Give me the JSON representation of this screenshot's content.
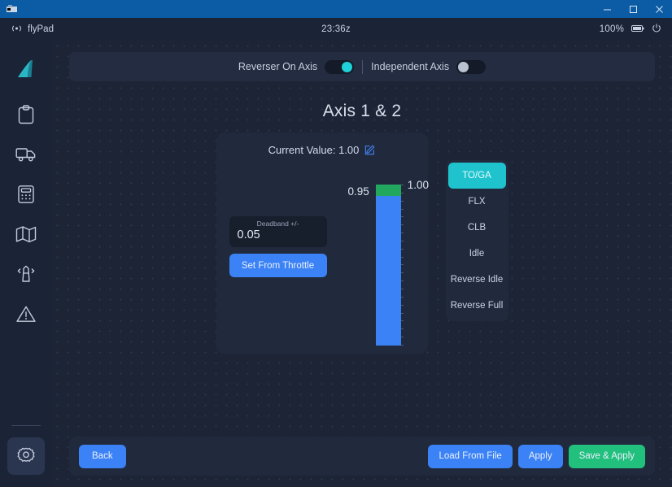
{
  "window": {
    "app_icon": "app-window-icon",
    "controls": {
      "minimize": "minimize-icon",
      "maximize": "maximize-icon",
      "close": "close-icon"
    }
  },
  "statusbar": {
    "connection_icon": "wifi-icon",
    "app_name": "flyPad",
    "time": "23:36z",
    "battery_percent": "100%",
    "battery_icon": "battery-icon",
    "power_icon": "power-icon"
  },
  "sidebar": {
    "items": [
      {
        "name": "dashboard",
        "icon": "aircraft-tail-logo-icon",
        "active": false
      },
      {
        "name": "dispatch",
        "icon": "clipboard-icon",
        "active": false
      },
      {
        "name": "ground",
        "icon": "truck-icon",
        "active": false
      },
      {
        "name": "performance",
        "icon": "calculator-icon",
        "active": false
      },
      {
        "name": "navigation",
        "icon": "map-icon",
        "active": false
      },
      {
        "name": "atc",
        "icon": "control-tower-icon",
        "active": false
      },
      {
        "name": "failures",
        "icon": "warning-triangle-icon",
        "active": false
      }
    ],
    "settings": {
      "name": "settings",
      "icon": "gear-icon",
      "active": true
    }
  },
  "toggles": [
    {
      "label": "Reverser On Axis",
      "state": "on"
    },
    {
      "label": "Independent Axis",
      "state": "off"
    }
  ],
  "axis_panel": {
    "title": "Axis 1 & 2",
    "current_value_label": "Current Value: 1.00",
    "edit_icon": "edit-pencil-square-icon",
    "deadband": {
      "label": "Deadband +/-",
      "value": "0.05"
    },
    "set_from_throttle_label": "Set From Throttle"
  },
  "meter": {
    "low_label": "0.95",
    "high_label": "1.00",
    "detent_color": "#22a75f",
    "fill_color": "#3b82f6",
    "detent_fraction": 0.07,
    "fill_fraction": 0.93,
    "tick_count": 21
  },
  "detents": [
    {
      "label": "TO/GA",
      "selected": true
    },
    {
      "label": "FLX",
      "selected": false
    },
    {
      "label": "CLB",
      "selected": false
    },
    {
      "label": "Idle",
      "selected": false
    },
    {
      "label": "Reverse Idle",
      "selected": false
    },
    {
      "label": "Reverse Full",
      "selected": false
    }
  ],
  "footer": {
    "back_label": "Back",
    "load_from_file_label": "Load From File",
    "apply_label": "Apply",
    "save_apply_label": "Save & Apply"
  },
  "colors": {
    "accent_blue": "#3b82f6",
    "accent_cyan": "#1fc3cd",
    "accent_green": "#21c07d",
    "panel": "#212a3d",
    "background": "#1c2435",
    "titlebar": "#0b5ca5"
  }
}
